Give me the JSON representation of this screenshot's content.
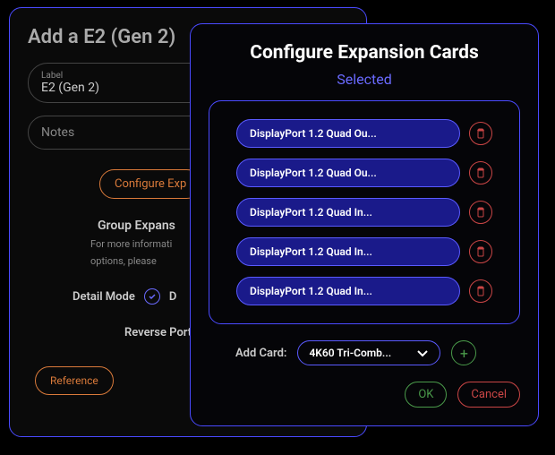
{
  "back": {
    "title": "Add a E2 (Gen 2)",
    "label_caption": "Label",
    "label_value": "E2 (Gen 2)",
    "notes_placeholder": "Notes",
    "configure_btn": "Configure Exp",
    "group_title": "Group Expans",
    "group_sub1": "For more informati",
    "group_sub2": "options, please",
    "detail_mode": "Detail Mode",
    "detail_d": "D",
    "reverse": "Reverse Port P",
    "reference": "Reference"
  },
  "front": {
    "title": "Configure Expansion Cards",
    "selected": "Selected",
    "cards": [
      "DisplayPort 1.2 Quad Ou...",
      "DisplayPort 1.2 Quad Ou...",
      "DisplayPort 1.2 Quad In...",
      "DisplayPort 1.2 Quad In...",
      "DisplayPort 1.2 Quad In..."
    ],
    "add_label": "Add Card:",
    "dropdown": "4K60 Tri-Comb...",
    "ok": "OK",
    "cancel": "Cancel"
  }
}
